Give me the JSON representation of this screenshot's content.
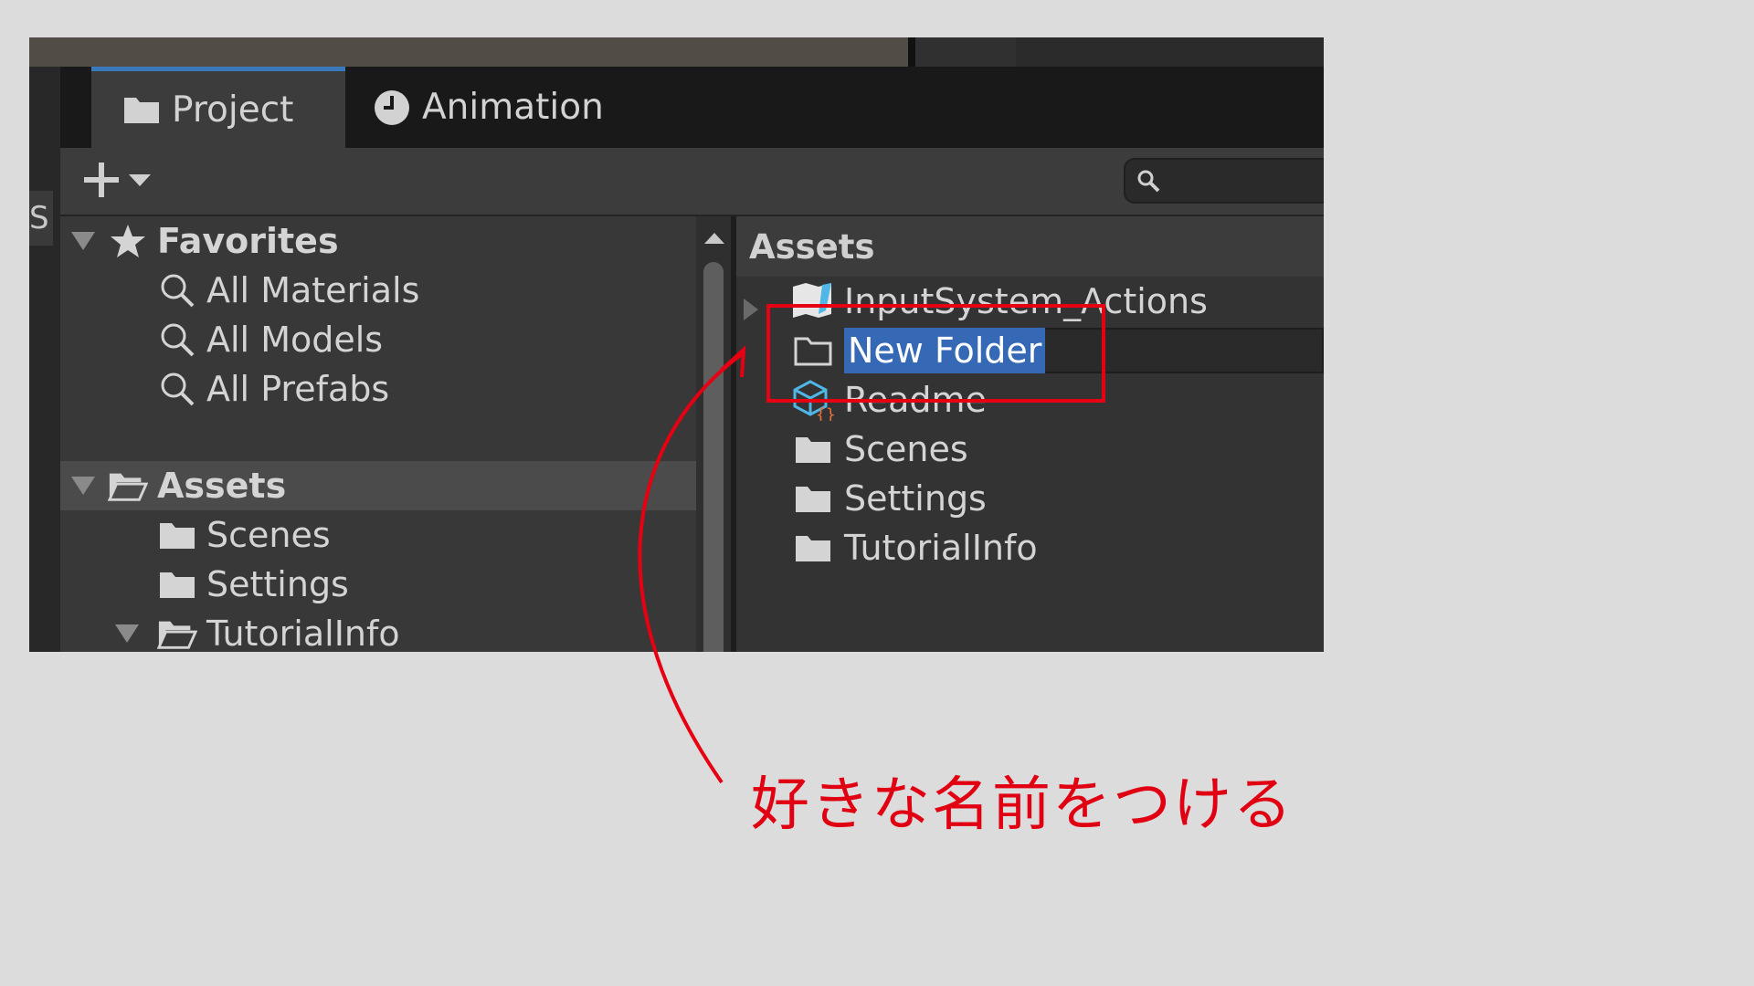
{
  "tabs": [
    {
      "label": "Project",
      "icon": "folder-icon",
      "active": true
    },
    {
      "label": "Animation",
      "icon": "clock-icon",
      "active": false
    }
  ],
  "left_panel_label": "S",
  "toolbar": {
    "add_icon": "plus-icon",
    "dropdown_icon": "chevron-down-icon",
    "search_icon": "search-icon"
  },
  "tree": {
    "favorites": {
      "label": "Favorites",
      "items": [
        "All Materials",
        "All Models",
        "All Prefabs"
      ]
    },
    "assets": {
      "label": "Assets",
      "items": [
        "Scenes",
        "Settings",
        "TutorialInfo"
      ]
    }
  },
  "content": {
    "header": "Assets",
    "items": [
      {
        "label": "InputSystem_Actions",
        "icon": "input-actions-icon"
      },
      {
        "label": "New Folder",
        "icon": "empty-folder-icon"
      },
      {
        "label": "Readme",
        "icon": "readme-asset-icon"
      },
      {
        "label": "Scenes",
        "icon": "folder-icon"
      },
      {
        "label": "Settings",
        "icon": "folder-icon"
      },
      {
        "label": "TutorialInfo",
        "icon": "folder-icon"
      }
    ]
  },
  "annotation": {
    "text": "好きな名前をつける",
    "color": "#e60012"
  }
}
